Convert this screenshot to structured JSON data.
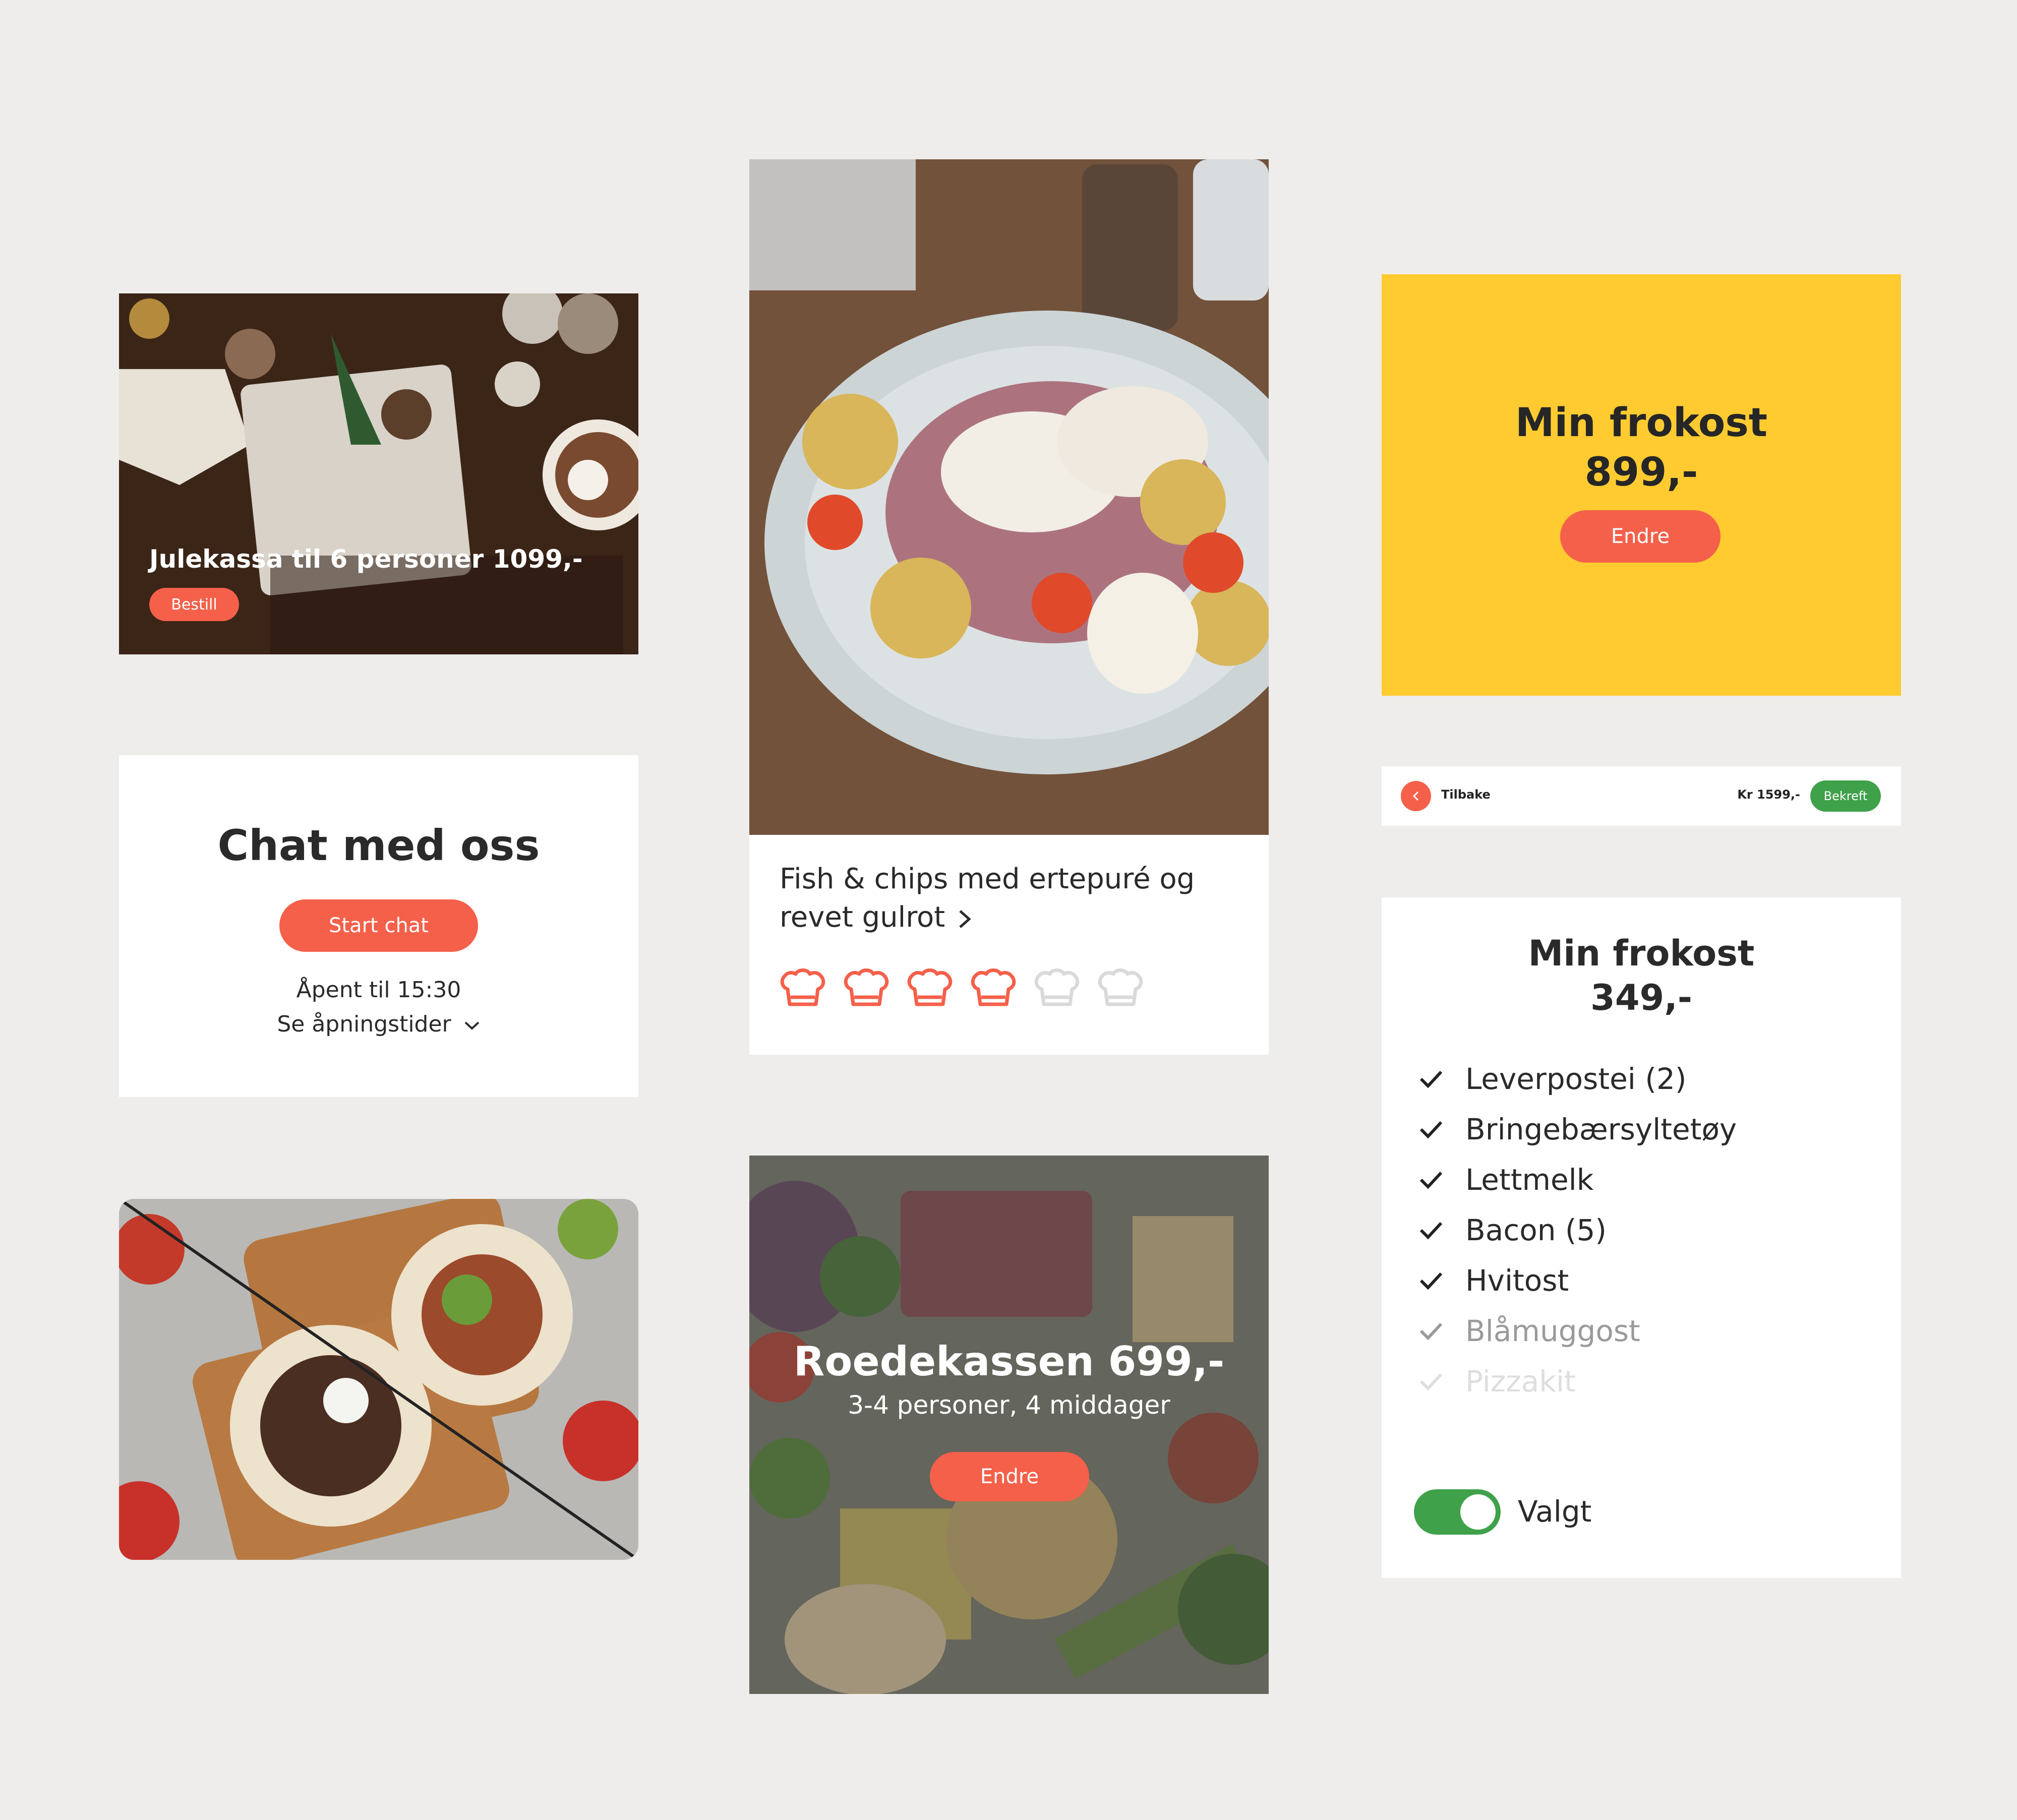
{
  "julekassa": {
    "title": "Julekassa til 6 personer 1099,-",
    "button": "Bestill"
  },
  "chat": {
    "title": "Chat med oss",
    "button": "Start chat",
    "hours": "Åpent til 15:30",
    "link": "Se åpningstider"
  },
  "recipe": {
    "title": "Fish & chips med ertepuré og revet gulrot",
    "difficulty": {
      "filled": 4,
      "total": 6
    },
    "colors": {
      "filled": "#f5604a",
      "empty": "#d9d9d9"
    }
  },
  "roedekassen": {
    "title": "Roedekassen 699,-",
    "subtitle": "3-4 personer, 4 middager",
    "button": "Endre"
  },
  "frokost_yellow": {
    "title": "Min frokost",
    "price": "899,-",
    "button": "Endre"
  },
  "navbar": {
    "back_label": "Tilbake",
    "price": "Kr 1599,-",
    "confirm": "Bekreft"
  },
  "frokost_list": {
    "title": "Min frokost",
    "price": "349,-",
    "items": [
      "Leverpostei (2)",
      "Bringebærsyltetøy",
      "Lettmelk",
      "Bacon (5)",
      "Hvitost",
      "Blåmuggost",
      "Pizzakit"
    ],
    "toggle_label": "Valgt",
    "toggle_on": true
  },
  "colors": {
    "accent": "#f5604a",
    "yellow": "#ffcb31",
    "green": "#3fa14a",
    "background": "#eeedeb"
  }
}
